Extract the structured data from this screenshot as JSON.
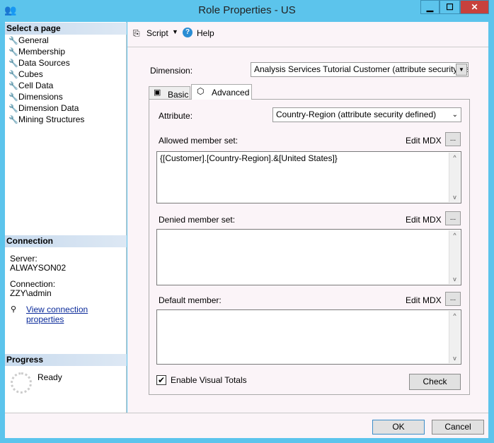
{
  "window": {
    "title": "Role Properties - US",
    "min": "▁",
    "max": "☐",
    "close": "✕"
  },
  "sidebar": {
    "header": "Select a page",
    "items": [
      {
        "label": "General"
      },
      {
        "label": "Membership"
      },
      {
        "label": "Data Sources"
      },
      {
        "label": "Cubes"
      },
      {
        "label": "Cell Data"
      },
      {
        "label": "Dimensions"
      },
      {
        "label": "Dimension Data"
      },
      {
        "label": "Mining Structures"
      }
    ]
  },
  "connection": {
    "header": "Connection",
    "server_label": "Server:",
    "server": "ALWAYSON02",
    "connection_label": "Connection:",
    "connection": "ZZY\\admin",
    "link": "View connection properties"
  },
  "progress": {
    "header": "Progress",
    "status": "Ready"
  },
  "toolbar": {
    "script": "Script",
    "help": "Help"
  },
  "main": {
    "dimension_label": "Dimension:",
    "dimension_value": "Analysis Services Tutorial Customer (attribute security defi...",
    "tabs": [
      {
        "label": "Basic"
      },
      {
        "label": "Advanced"
      }
    ],
    "attribute_label": "Attribute:",
    "attribute_value": "Country-Region (attribute security defined)",
    "allowed_label": "Allowed member set:",
    "allowed_value": "{[Customer].[Country-Region].&[United States]}",
    "denied_label": "Denied member set:",
    "denied_value": "",
    "default_label": "Default member:",
    "default_value": "",
    "edit_mdx": "Edit MDX",
    "ellipsis": "...",
    "visual_totals": "Enable Visual Totals",
    "visual_totals_checked": true,
    "check": "Check"
  },
  "footer": {
    "ok": "OK",
    "cancel": "Cancel"
  }
}
